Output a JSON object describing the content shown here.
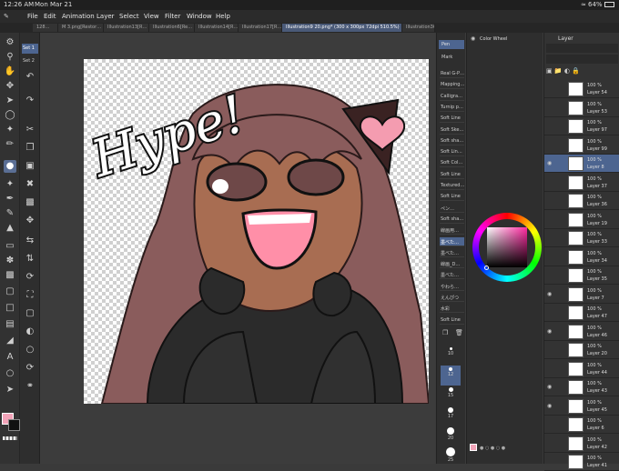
{
  "status": {
    "time": "12:26 AM",
    "date": "Mon Mar 21",
    "battery": "64%"
  },
  "menu": [
    "File",
    "Edit",
    "Animation",
    "Layer",
    "Select",
    "View",
    "Filter",
    "Window",
    "Help"
  ],
  "tabs": [
    "128…",
    "M 3.png[Restor…",
    "Illustration13[R…",
    "Illustration6[Re…",
    "Illustration14[R…",
    "Illustration17[R…",
    "Illustration9 20.png* (300 x 300px 72dpi 510.5%)",
    "Illustration36"
  ],
  "subtool": {
    "set1": "Set 1",
    "set2": "Set 2"
  },
  "brushes": {
    "tab_pen": "Pen",
    "tab_marker": "Mark",
    "items": [
      "Real G-P…",
      "Mapping…",
      "Calligra…",
      "Turnip p…",
      "Soft Line",
      "Soft Ske…",
      "Soft sha…",
      "Soft Lin…",
      "Soft Col…",
      "Soft Line",
      "Textured…",
      "Soft Line",
      "ペン…",
      "Soft sha…",
      "線画用…",
      "墨べた…",
      "墨べた…",
      "線画_D…",
      "墨べた…",
      "やわら…",
      "えんぴつ",
      "水彩",
      "Soft Line"
    ],
    "sizes": [
      "10",
      "12",
      "15",
      "17",
      "20",
      "25"
    ]
  },
  "color_wheel": {
    "title": "Color Wheel"
  },
  "layer_panel": {
    "title": "Layer",
    "layers": [
      {
        "pct": "100 %",
        "name": "Layer 54"
      },
      {
        "pct": "100 %",
        "name": "Layer 53"
      },
      {
        "pct": "100 %",
        "name": "Layer 97"
      },
      {
        "pct": "100 %",
        "name": "Layer 99"
      },
      {
        "pct": "100 %",
        "name": "Layer 8"
      },
      {
        "pct": "100 %",
        "name": "Layer 37"
      },
      {
        "pct": "100 %",
        "name": "Layer 36"
      },
      {
        "pct": "100 %",
        "name": "Layer 19"
      },
      {
        "pct": "100 %",
        "name": "Layer 33"
      },
      {
        "pct": "100 %",
        "name": "Layer 34"
      },
      {
        "pct": "100 %",
        "name": "Layer 35"
      },
      {
        "pct": "100 %",
        "name": "Layer 7"
      },
      {
        "pct": "100 %",
        "name": "Layer 47"
      },
      {
        "pct": "100 %",
        "name": "Layer 46"
      },
      {
        "pct": "100 %",
        "name": "Layer 20"
      },
      {
        "pct": "100 %",
        "name": "Layer 44"
      },
      {
        "pct": "100 %",
        "name": "Layer 43"
      },
      {
        "pct": "100 %",
        "name": "Layer 45"
      },
      {
        "pct": "100 %",
        "name": "Layer 6"
      },
      {
        "pct": "100 %",
        "name": "Layer 42"
      },
      {
        "pct": "100 %",
        "name": "Layer 41"
      }
    ]
  },
  "artwork_text": "Hype!",
  "colors": {
    "main": "#f2a3b8",
    "sub": "#111111",
    "accent": "#4d6590",
    "hair": "#8a5c5c",
    "skin": "#a86d52",
    "heart": "#f49cb0"
  }
}
